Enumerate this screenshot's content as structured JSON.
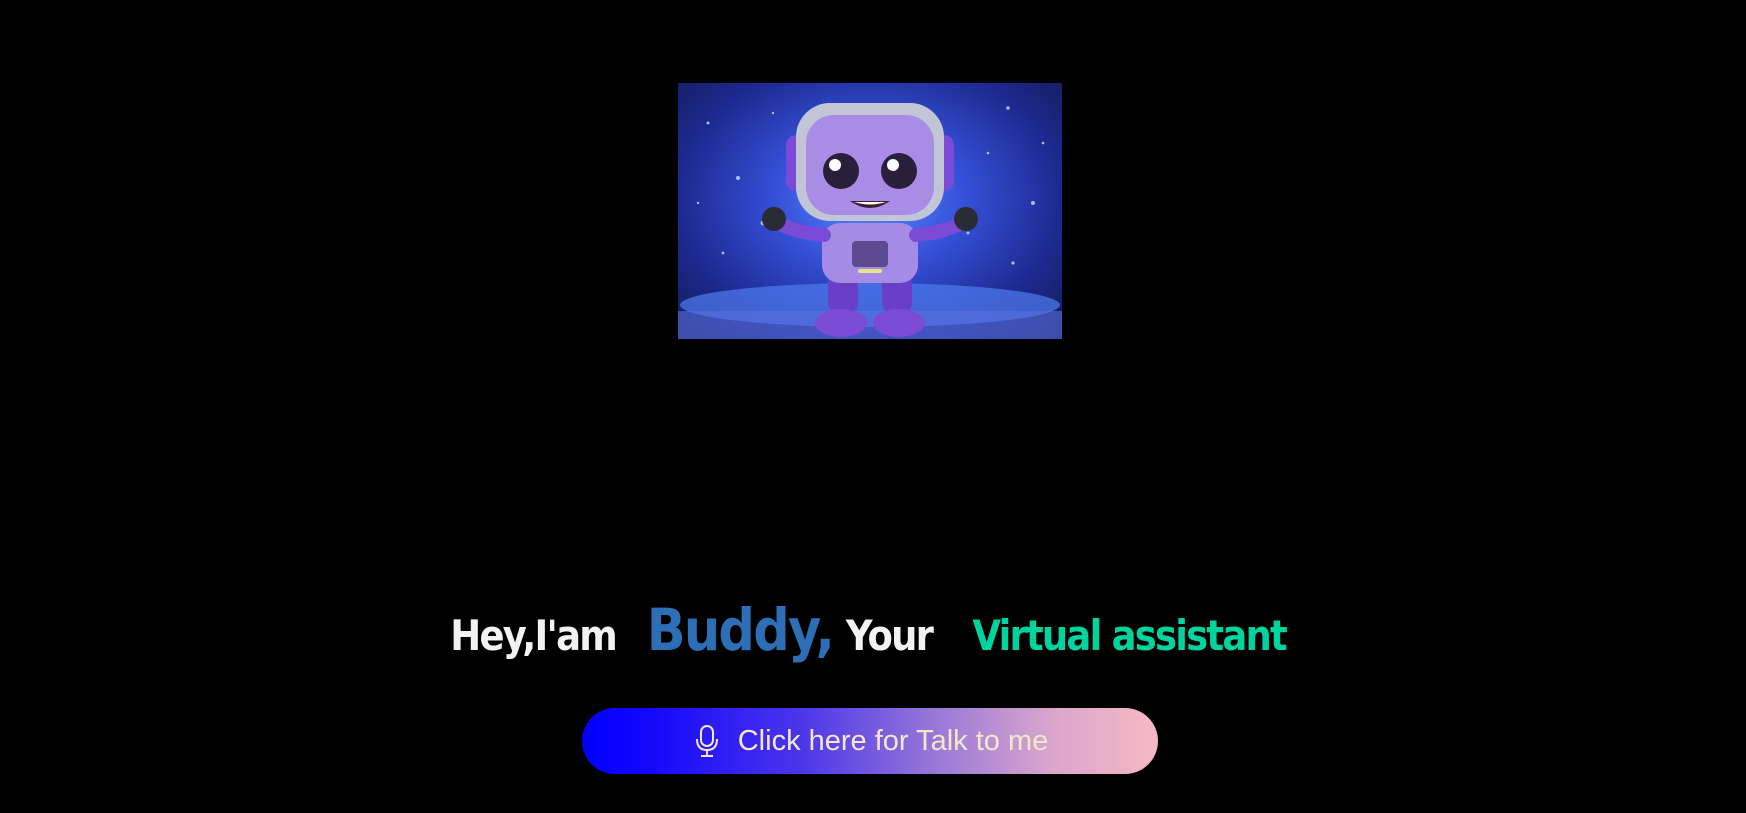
{
  "hero": {
    "image_name": "robot-mascot-image"
  },
  "headline": {
    "prefix": "Hey,I'am",
    "name": "Buddy,",
    "middle": "Your",
    "role": "Virtual assistant"
  },
  "talk_button": {
    "label": "Click here for Talk to me",
    "icon": "microphone-icon"
  },
  "colors": {
    "background": "#000000",
    "name_accent": "#2d6fb6",
    "role_accent": "#00d49e",
    "button_gradient_start": "#0000ff",
    "button_gradient_end": "#f5b9c2",
    "button_text": "#f4e6c8"
  }
}
